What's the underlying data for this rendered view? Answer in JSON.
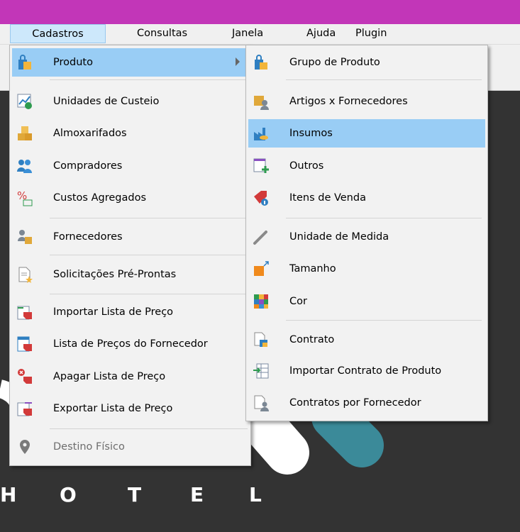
{
  "menubar": {
    "items": [
      "Cadastros",
      "Consultas",
      "Janela",
      "Ajuda",
      "Plugin"
    ]
  },
  "menu_cadastros": {
    "items": [
      {
        "label": "Produto",
        "icon": "produto-bag-icon"
      },
      {
        "label": "Unidades de Custeio",
        "icon": "chart-money-icon"
      },
      {
        "label": "Almoxarifados",
        "icon": "boxes-icon"
      },
      {
        "label": "Compradores",
        "icon": "people-icon"
      },
      {
        "label": "Custos Agregados",
        "icon": "percent-icon"
      },
      {
        "label": "Fornecedores",
        "icon": "supplier-icon"
      },
      {
        "label": "Solicitações Pré-Prontas",
        "icon": "document-star-icon"
      },
      {
        "label": "Importar Lista de Preço",
        "icon": "import-price-icon"
      },
      {
        "label": "Lista de Preços do Fornecedor",
        "icon": "price-list-icon"
      },
      {
        "label": "Apagar Lista de Preço",
        "icon": "delete-price-icon"
      },
      {
        "label": "Exportar Lista de Preço",
        "icon": "export-price-icon"
      },
      {
        "label": "Destino Físico",
        "icon": "location-pin-icon"
      }
    ]
  },
  "menu_produto": {
    "items": [
      {
        "label": "Grupo de Produto",
        "icon": "product-group-icon"
      },
      {
        "label": "Artigos x Fornecedores",
        "icon": "articles-suppliers-icon"
      },
      {
        "label": "Insumos",
        "icon": "factory-icon"
      },
      {
        "label": "Outros",
        "icon": "list-add-icon"
      },
      {
        "label": "Itens de Venda",
        "icon": "sale-tag-icon"
      },
      {
        "label": "Unidade de Medida",
        "icon": "pen-icon"
      },
      {
        "label": "Tamanho",
        "icon": "resize-icon"
      },
      {
        "label": "Cor",
        "icon": "color-grid-icon"
      },
      {
        "label": "Contrato",
        "icon": "contract-icon"
      },
      {
        "label": "Importar Contrato de Produto",
        "icon": "import-table-icon"
      },
      {
        "label": "Contratos por Fornecedor",
        "icon": "contract-person-icon"
      }
    ]
  },
  "background": {
    "hotel_letters": [
      "H",
      "O",
      "T",
      "E",
      "L"
    ]
  },
  "colors": {
    "titlebar": "#c236b8",
    "highlight": "#99cdf5",
    "teal_shape": "#3b8a99"
  }
}
